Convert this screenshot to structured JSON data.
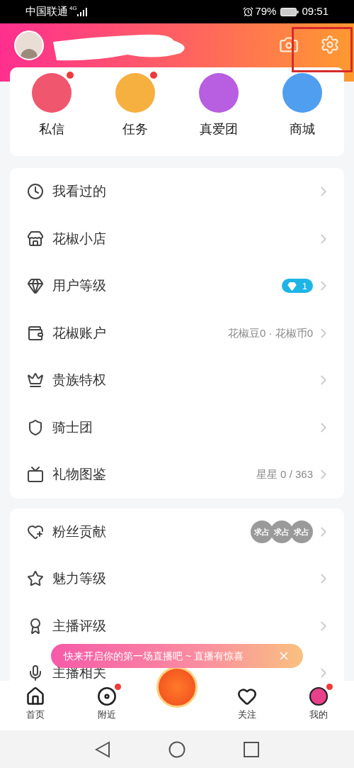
{
  "status_bar": {
    "carrier": "中国联通",
    "network": "4G",
    "battery": "79%",
    "time": "09:51"
  },
  "quick_actions": [
    {
      "label": "私信",
      "badge": true,
      "color": "#f0566e"
    },
    {
      "label": "任务",
      "badge": true,
      "color": "#f6b040"
    },
    {
      "label": "真爱团",
      "badge": false,
      "color": "#b85ee0"
    },
    {
      "label": "商城",
      "badge": false,
      "color": "#4f9ef0"
    }
  ],
  "menu_sections": [
    {
      "rows": [
        {
          "kind": "plain",
          "label": "我看过的"
        },
        {
          "kind": "plain",
          "label": "花椒小店"
        },
        {
          "kind": "level",
          "label": "用户等级",
          "value": "1"
        },
        {
          "kind": "text",
          "label": "花椒账户",
          "value": "花椒豆0 · 花椒币0"
        },
        {
          "kind": "plain",
          "label": "贵族特权"
        },
        {
          "kind": "plain",
          "label": "骑士团"
        },
        {
          "kind": "text",
          "label": "礼物图鉴",
          "value": "星星 0 / 363"
        }
      ]
    },
    {
      "rows": [
        {
          "kind": "fans",
          "label": "粉丝贡献",
          "fans": [
            "求占",
            "求占",
            "求占"
          ]
        },
        {
          "kind": "plain",
          "label": "魅力等级"
        },
        {
          "kind": "plain",
          "label": "主播评级"
        },
        {
          "kind": "plain",
          "label": "主播相关"
        }
      ]
    }
  ],
  "tooltip": "快来开启你的第一场直播吧 ~ 直播有惊喜",
  "bottom_nav": [
    {
      "kind": "tab",
      "label": "首页",
      "badge": false
    },
    {
      "kind": "tab",
      "label": "附近",
      "badge": true
    },
    {
      "kind": "live"
    },
    {
      "kind": "tab",
      "label": "关注",
      "badge": false
    },
    {
      "kind": "tab",
      "label": "我的",
      "badge": true
    }
  ]
}
